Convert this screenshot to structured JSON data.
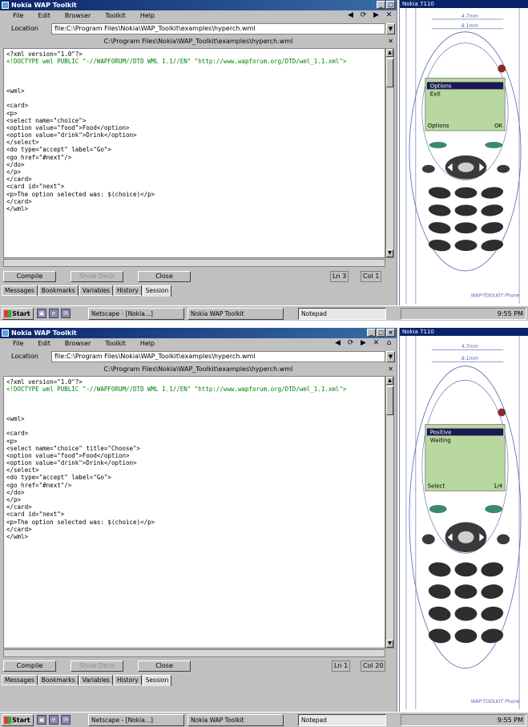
{
  "screens": {
    "top": {
      "window_title": "Nokia WAP Toolkit",
      "menu": [
        "File",
        "Edit",
        "Browser",
        "Toolkit",
        "Help"
      ],
      "location_label": "Location",
      "location_value": "file:C:\\Program Files\\Nokia\\WAP_Toolkit\\examples\\hyperch.wml",
      "doc_title": "C:\\Program Files\\Nokia\\WAP_Toolkit\\examples\\hyperch.wml",
      "code_lines": [
        "<?xml version=\"1.0\"?>",
        "<!DOCTYPE wml PUBLIC \"-//WAPFORUM//DTD WML 1.1//EN\" \"http://www.wapforum.org/DTD/wml_1.1.xml\">",
        "",
        "",
        "",
        "<wml>",
        "",
        "<card>",
        "<p>",
        "<select name=\"choice\">",
        "<option value=\"food\">Food</option>",
        "<option value=\"drink\">Drink</option>",
        "</select>",
        "<do type=\"accept\" label=\"Go\">",
        "<go href=\"#next\"/>",
        "</do>",
        "</p>",
        "</card>",
        "<card id=\"next\">",
        "<p>The option selected was: $(choice)</p>",
        "</card>",
        "</wml>"
      ],
      "buttons": [
        "Compile",
        "Show Deck",
        "Close"
      ],
      "position": "Ln 3",
      "position_col": "Col 1",
      "tabs": [
        "Messages",
        "Bookmarks",
        "Variables",
        "History",
        "Session"
      ],
      "taskbar": {
        "start": "Start",
        "tasks": [
          "Netscape - [Nokia...]",
          "Nokia WAP Toolkit",
          "Notepad"
        ],
        "clock": "9:55 PM"
      },
      "phone": {
        "sim_title": "Nokia 7110",
        "menu_items": [
          "Options",
          "Exit"
        ],
        "selected_index": 0,
        "softkey_left": "Options",
        "softkey_right": "OK",
        "dims": [
          "4.7mm",
          "8.1mm"
        ],
        "footer": "WAP-TOOLKIT Phone"
      }
    },
    "bottom": {
      "window_title": "Nokia WAP Toolkit",
      "menu": [
        "File",
        "Edit",
        "Browser",
        "Toolkit",
        "Help"
      ],
      "location_label": "Location",
      "location_value": "file:C:\\Program Files\\Nokia\\WAP_Toolkit\\examples\\hyperch.wml",
      "doc_title": "C:\\Program Files\\Nokia\\WAP_Toolkit\\examples\\hyperch.wml",
      "code_lines": [
        "<?xml version=\"1.0\"?>",
        "<!DOCTYPE wml PUBLIC \"-//WAPFORUM//DTD WML 1.1//EN\" \"http://www.wapforum.org/DTD/wml_1.1.xml\">",
        "",
        "",
        "",
        "<wml>",
        "",
        "<card>",
        "<p>",
        "<select name=\"choice\" title=\"Choose\">",
        "<option value=\"food\">Food</option>",
        "<option value=\"drink\">Drink</option>",
        "</select>",
        "<do type=\"accept\" label=\"Go\">",
        "<go href=\"#next\"/>",
        "</do>",
        "</p>",
        "</card>",
        "<card id=\"next\">",
        "<p>The option selected was: $(choice)</p>",
        "</card>",
        "</wml>"
      ],
      "buttons": [
        "Compile",
        "Show Deck",
        "Close"
      ],
      "position": "Ln 1",
      "position_col": "Col 20",
      "tabs": [
        "Messages",
        "Bookmarks",
        "Variables",
        "History",
        "Session"
      ],
      "taskbar": {
        "start": "Start",
        "tasks": [
          "Netscape - [Nokia...]",
          "Nokia WAP Toolkit",
          "Notepad"
        ],
        "clock": "9:55 PM"
      },
      "phone": {
        "sim_title": "Nokia 7110",
        "menu_items": [
          "Positive",
          "Waiting"
        ],
        "selected_index": 0,
        "softkey_left": "Select",
        "softkey_right": "1/4",
        "dims": [
          "4.7mm",
          "8.1mm"
        ],
        "footer": "WAP-TOOLKIT Phone"
      }
    }
  },
  "colors": {
    "titlebar": "#0a246a",
    "code_green": "#008000",
    "phone_screen": "#b8d8a0",
    "blueprint": "#5566b0"
  }
}
